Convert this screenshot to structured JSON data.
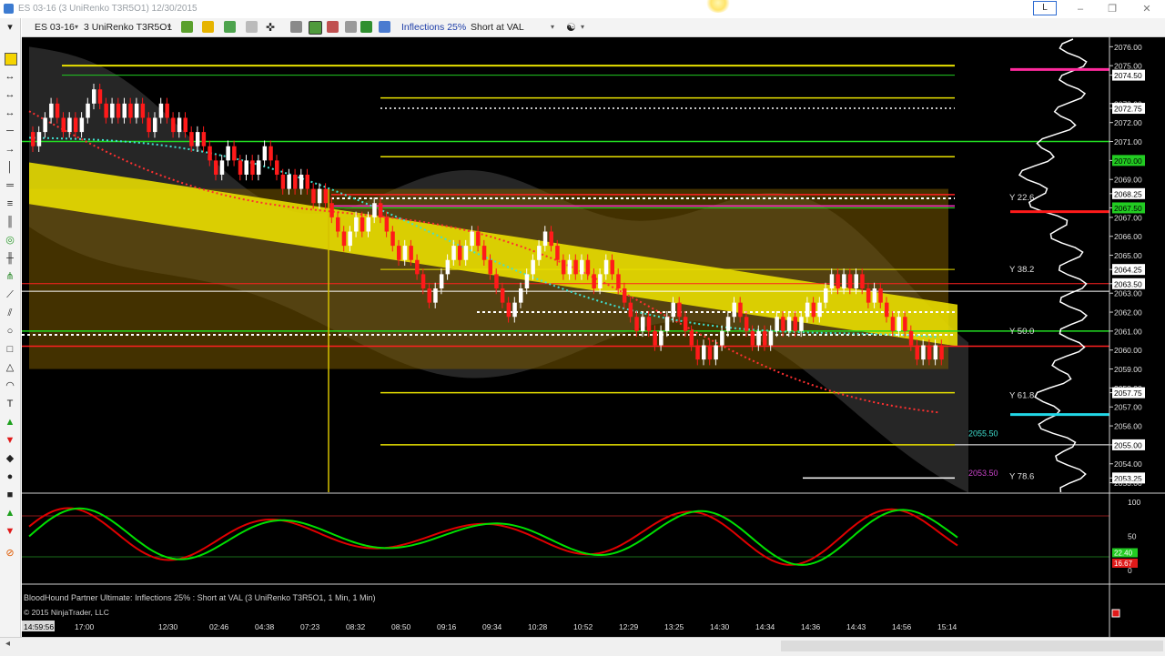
{
  "window": {
    "title": "ES 03-16 (3 UniRenko T3R5O1)  12/30/2015",
    "minimize": "–",
    "restore_box": "L",
    "maximize": "❐",
    "close": "✕"
  },
  "toolbar": {
    "instrument": "ES 03-16",
    "interval": "3 UniRenko T3R5O1",
    "indicator_label": "Inflections 25%",
    "strategy_select": "Short at VAL"
  },
  "chart": {
    "y_axis_labels": [
      "2076.00",
      "2075.00",
      "2074.50",
      "2073.00",
      "2072.75",
      "2072.00",
      "2071.00",
      "2070.00",
      "2069.00",
      "2068.25",
      "2067.50",
      "2067.00",
      "2066.00",
      "2065.00",
      "2064.25",
      "2063.50",
      "2063.00",
      "2062.00",
      "2061.00",
      "2060.00",
      "2059.00",
      "2058.00",
      "2057.75",
      "2057.00",
      "2056.00",
      "2055.00",
      "2054.00",
      "2053.25",
      "2053.00"
    ],
    "y_labels": [
      "Y 22.6",
      "Y 38.2",
      "Y 50.0",
      "Y 61.8",
      "Y 78.6"
    ],
    "price_tags": [
      "2055.50",
      "2053.50"
    ],
    "time_labels": [
      "14:59:56",
      "17:00",
      "12/30",
      "02:46",
      "04:38",
      "07:23",
      "08:32",
      "08:50",
      "09:16",
      "09:34",
      "10:28",
      "10:52",
      "12:29",
      "13:25",
      "14:30",
      "14:34",
      "14:36",
      "14:43",
      "14:56",
      "15:14"
    ],
    "oscillator_axis": [
      "100",
      "50",
      "0"
    ],
    "oscillator_values": [
      "22.40",
      "16.67"
    ],
    "status_line": "BloodHound Partner Ultimate: Inflections 25% : Short at VAL (3 UniRenko T3R5O1, 1 Min, 1 Min)",
    "copyright": "© 2015 NinjaTrader, LLC",
    "colors": {
      "background": "#000000",
      "up_candle": "#ffffff",
      "down_candle": "#ff1a1a",
      "value_band": "#f2e600",
      "cloud": "#7a5a00",
      "oscillator_fast": "#00e000",
      "oscillator_slow": "#e00000"
    }
  }
}
